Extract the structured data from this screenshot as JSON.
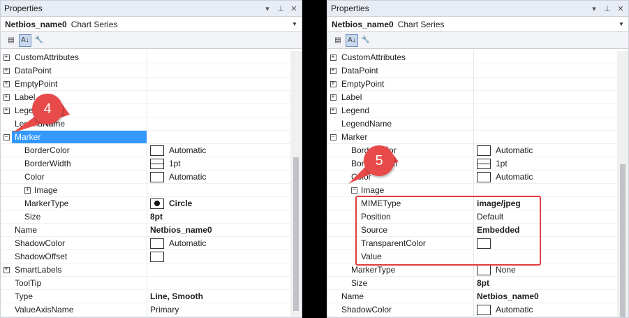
{
  "left": {
    "title": "Properties",
    "object_name": "Netbios_name0",
    "object_type": "Chart Series",
    "callout": "4",
    "rows": [
      {
        "name": "CustomAttributes",
        "indent": 0,
        "exp": "+",
        "value": "",
        "swatch": "",
        "bold": false,
        "sel": false
      },
      {
        "name": "DataPoint",
        "indent": 0,
        "exp": "+",
        "value": "",
        "swatch": "",
        "bold": false,
        "sel": false
      },
      {
        "name": "EmptyPoint",
        "indent": 0,
        "exp": "+",
        "value": "",
        "swatch": "",
        "bold": false,
        "sel": false
      },
      {
        "name": "Label",
        "indent": 0,
        "exp": "+",
        "value": "",
        "swatch": "",
        "bold": false,
        "sel": false
      },
      {
        "name": "Legend",
        "indent": 0,
        "exp": "+",
        "value": "",
        "swatch": "",
        "bold": false,
        "sel": false
      },
      {
        "name": "LegendName",
        "indent": 0,
        "exp": "",
        "value": "",
        "swatch": "",
        "bold": false,
        "sel": false
      },
      {
        "name": "Marker",
        "indent": 0,
        "exp": "-",
        "value": "",
        "swatch": "",
        "bold": false,
        "sel": true
      },
      {
        "name": "BorderColor",
        "indent": 1,
        "exp": "",
        "value": "Automatic",
        "swatch": "box",
        "bold": false,
        "sel": false
      },
      {
        "name": "BorderWidth",
        "indent": 1,
        "exp": "",
        "value": "1pt",
        "swatch": "line",
        "bold": false,
        "sel": false
      },
      {
        "name": "Color",
        "indent": 1,
        "exp": "",
        "value": "Automatic",
        "swatch": "box",
        "bold": false,
        "sel": false
      },
      {
        "name": "Image",
        "indent": 1,
        "exp": "+",
        "value": "",
        "swatch": "",
        "bold": false,
        "sel": false
      },
      {
        "name": "MarkerType",
        "indent": 1,
        "exp": "",
        "value": "Circle",
        "swatch": "dot",
        "bold": true,
        "sel": false
      },
      {
        "name": "Size",
        "indent": 1,
        "exp": "",
        "value": "8pt",
        "swatch": "",
        "bold": true,
        "sel": false
      },
      {
        "name": "Name",
        "indent": 0,
        "exp": "",
        "value": "Netbios_name0",
        "swatch": "",
        "bold": true,
        "sel": false
      },
      {
        "name": "ShadowColor",
        "indent": 0,
        "exp": "",
        "value": "Automatic",
        "swatch": "box",
        "bold": false,
        "sel": false
      },
      {
        "name": "ShadowOffset",
        "indent": 0,
        "exp": "",
        "value": "",
        "swatch": "box",
        "bold": false,
        "sel": false
      },
      {
        "name": "SmartLabels",
        "indent": 0,
        "exp": "+",
        "value": "",
        "swatch": "",
        "bold": false,
        "sel": false
      },
      {
        "name": "ToolTip",
        "indent": 0,
        "exp": "",
        "value": "",
        "swatch": "",
        "bold": false,
        "sel": false
      },
      {
        "name": "Type",
        "indent": 0,
        "exp": "",
        "value": "Line, Smooth",
        "swatch": "",
        "bold": true,
        "sel": false
      },
      {
        "name": "ValueAxisName",
        "indent": 0,
        "exp": "",
        "value": "Primary",
        "swatch": "",
        "bold": false,
        "sel": false
      }
    ]
  },
  "right": {
    "title": "Properties",
    "object_name": "Netbios_name0",
    "object_type": "Chart Series",
    "callout": "5",
    "rows": [
      {
        "name": "CustomAttributes",
        "indent": 0,
        "exp": "+",
        "value": "",
        "swatch": "",
        "bold": false,
        "sel": false
      },
      {
        "name": "DataPoint",
        "indent": 0,
        "exp": "+",
        "value": "",
        "swatch": "",
        "bold": false,
        "sel": false
      },
      {
        "name": "EmptyPoint",
        "indent": 0,
        "exp": "+",
        "value": "",
        "swatch": "",
        "bold": false,
        "sel": false
      },
      {
        "name": "Label",
        "indent": 0,
        "exp": "+",
        "value": "",
        "swatch": "",
        "bold": false,
        "sel": false
      },
      {
        "name": "Legend",
        "indent": 0,
        "exp": "+",
        "value": "",
        "swatch": "",
        "bold": false,
        "sel": false
      },
      {
        "name": "LegendName",
        "indent": 0,
        "exp": "",
        "value": "",
        "swatch": "",
        "bold": false,
        "sel": false
      },
      {
        "name": "Marker",
        "indent": 0,
        "exp": "-",
        "value": "",
        "swatch": "",
        "bold": false,
        "sel": false
      },
      {
        "name": "BorderColor",
        "indent": 1,
        "exp": "",
        "value": "Automatic",
        "swatch": "box",
        "bold": false,
        "sel": false
      },
      {
        "name": "BorderWidth",
        "indent": 1,
        "exp": "",
        "value": "1pt",
        "swatch": "line",
        "bold": false,
        "sel": false
      },
      {
        "name": "Color",
        "indent": 1,
        "exp": "",
        "value": "Automatic",
        "swatch": "box",
        "bold": false,
        "sel": false
      },
      {
        "name": "Image",
        "indent": 1,
        "exp": "-",
        "value": "",
        "swatch": "",
        "bold": false,
        "sel": false
      },
      {
        "name": "MIMEType",
        "indent": 2,
        "exp": "",
        "value": "image/jpeg",
        "swatch": "",
        "bold": true,
        "sel": false
      },
      {
        "name": "Position",
        "indent": 2,
        "exp": "",
        "value": "Default",
        "swatch": "",
        "bold": false,
        "sel": false
      },
      {
        "name": "Source",
        "indent": 2,
        "exp": "",
        "value": "Embedded",
        "swatch": "",
        "bold": true,
        "sel": false
      },
      {
        "name": "TransparentColor",
        "indent": 2,
        "exp": "",
        "value": "",
        "swatch": "box",
        "bold": false,
        "sel": false
      },
      {
        "name": "Value",
        "indent": 2,
        "exp": "",
        "value": "",
        "swatch": "",
        "bold": false,
        "sel": false
      },
      {
        "name": "MarkerType",
        "indent": 1,
        "exp": "",
        "value": "None",
        "swatch": "box",
        "bold": false,
        "sel": false
      },
      {
        "name": "Size",
        "indent": 1,
        "exp": "",
        "value": "8pt",
        "swatch": "",
        "bold": true,
        "sel": false
      },
      {
        "name": "Name",
        "indent": 0,
        "exp": "",
        "value": "Netbios_name0",
        "swatch": "",
        "bold": true,
        "sel": false
      },
      {
        "name": "ShadowColor",
        "indent": 0,
        "exp": "",
        "value": "Automatic",
        "swatch": "box",
        "bold": false,
        "sel": false
      }
    ]
  },
  "colors": {
    "selection": "#3399ff",
    "callout": "#e84a4a",
    "highlight_box": "#e03c3c"
  },
  "icons": {
    "categorized": "categorized-icon",
    "alphabetical": "alphabetical-icon",
    "property_pages": "wrench-icon"
  }
}
